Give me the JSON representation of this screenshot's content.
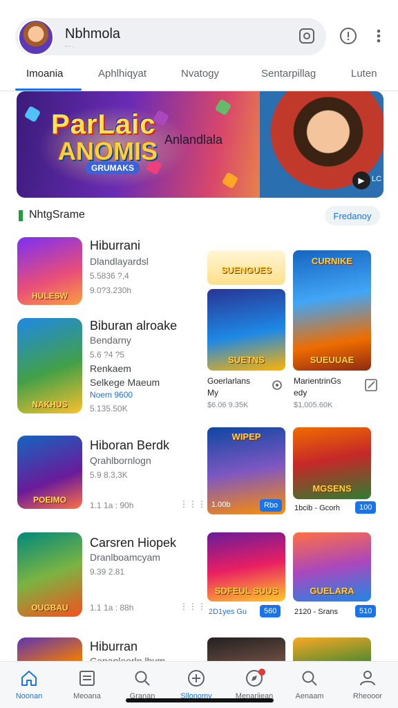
{
  "header": {
    "title": "Nbhmola",
    "subtitle": "ᵔ ᵔ ·",
    "icons": [
      "avatar",
      "camera-icon",
      "alert-icon",
      "more-vert-icon"
    ]
  },
  "tabs": [
    {
      "label": "Imoania",
      "active": true
    },
    {
      "label": "Aphlhiqyat",
      "active": false
    },
    {
      "label": "Nvatogy",
      "active": false
    },
    {
      "label": "Sentarpillag",
      "active": false
    },
    {
      "label": "Luten",
      "active": false
    }
  ],
  "banner": {
    "logo_line1": "ParLaic",
    "logo_line2": "ANOMIS",
    "logo_line3": "GRUMAKS",
    "caption": "Anlandlala",
    "badge": "LC"
  },
  "section": {
    "title": "NhtgSrame",
    "button": "Fredanoy"
  },
  "list": [
    {
      "icon_label": "HULESW",
      "title": "Hiburrani",
      "sub": "Dlandlayardsl",
      "meta1": "5.5836 ?,4",
      "meta2": "9.0?3.230h"
    },
    {
      "icon_label": "NAKHUS",
      "title": "Biburan alroake",
      "sub": "Bendarny",
      "meta1": "5.6 ?4 ?5",
      "sub2": "Renkaem",
      "sub3": "Selkege Maeum",
      "meta_blue": "Noem 9600",
      "meta2": "5.135.50K"
    },
    {
      "icon_label": "POEIMO",
      "title": "Hiboran Berdk",
      "sub": "Qrahlbornlogn",
      "meta1": "5.9 8.3,3K",
      "meta2": "1.1 1a : 90h",
      "dots": "⋮⋮⋮"
    },
    {
      "icon_label": "OUGBAU",
      "title": "Carsren Hiopek",
      "sub": "Dranlboamcyam",
      "meta1": "9.39 2.81",
      "meta2": "1.1 1a : 88h",
      "dots": "⋮⋮⋮"
    },
    {
      "icon_label": "",
      "title": "Hiburran",
      "sub": "Cananleorln lhvm"
    }
  ],
  "tiles": [
    {
      "label": "SUENGUES",
      "cap_only": true
    },
    {
      "label": "CURNIKE"
    },
    {
      "label": "SUETNS",
      "title": "Goerlarlans",
      "title2": "My",
      "meta": "$6.06 9.35K"
    },
    {
      "label": "SUEUUAE",
      "title": "MarientrinGs",
      "title2": "edy",
      "meta": "$1,005.60K"
    },
    {
      "label": "WIPEP",
      "cap": "1.00b",
      "tag": "Rbo"
    },
    {
      "label": "MGSENS",
      "cap": "1bcib - Gcorh",
      "tag": "100"
    },
    {
      "label": "SDFEUL SUUS",
      "cap": "2D1yes Gu",
      "tag": "560"
    },
    {
      "label": "GUELARA",
      "cap": "2120 - Srans",
      "tag": "510"
    }
  ],
  "bottom_nav": [
    {
      "label": "Noonan",
      "icon": "home-icon",
      "active": true
    },
    {
      "label": "Meoana",
      "icon": "document-icon",
      "active": false
    },
    {
      "label": "Granan",
      "icon": "search-icon",
      "active": false
    },
    {
      "label": "Sllonomy",
      "icon": "add-icon",
      "active": false
    },
    {
      "label": "Menariiean",
      "icon": "compass-icon",
      "active": false,
      "badge": true
    },
    {
      "label": "Aenaam",
      "icon": "search-icon",
      "active": false
    },
    {
      "label": "Rheooor",
      "icon": "profile-icon",
      "active": false
    }
  ]
}
